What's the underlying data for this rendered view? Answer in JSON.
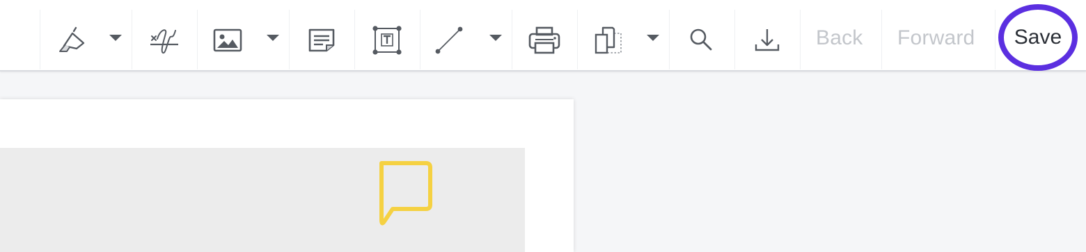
{
  "toolbar": {
    "tools": [
      {
        "name": "highlight-tool",
        "icon": "highlighter-icon",
        "has_dropdown": true
      },
      {
        "name": "signature-tool",
        "icon": "signature-icon",
        "has_dropdown": false
      },
      {
        "name": "image-tool",
        "icon": "image-icon",
        "has_dropdown": true
      },
      {
        "name": "sticky-note-tool",
        "icon": "sticky-note-icon",
        "has_dropdown": false
      },
      {
        "name": "text-box-tool",
        "icon": "text-box-icon",
        "has_dropdown": false
      },
      {
        "name": "line-tool",
        "icon": "line-icon",
        "has_dropdown": true
      },
      {
        "name": "print-tool",
        "icon": "printer-icon",
        "has_dropdown": false
      },
      {
        "name": "pages-tool",
        "icon": "pages-icon",
        "has_dropdown": true
      },
      {
        "name": "search-tool",
        "icon": "search-icon",
        "has_dropdown": false
      },
      {
        "name": "download-tool",
        "icon": "download-icon",
        "has_dropdown": false
      }
    ],
    "back_label": "Back",
    "forward_label": "Forward",
    "save_label": "Save"
  },
  "colors": {
    "icon": "#555a61",
    "disabled_text": "#c3c6cb",
    "save_highlight": "#5b2fe0",
    "comment_note": "#f5d142",
    "content_block": "#ececec"
  },
  "document": {
    "annotations": [
      {
        "type": "comment",
        "icon": "comment-bubble-icon"
      }
    ]
  }
}
